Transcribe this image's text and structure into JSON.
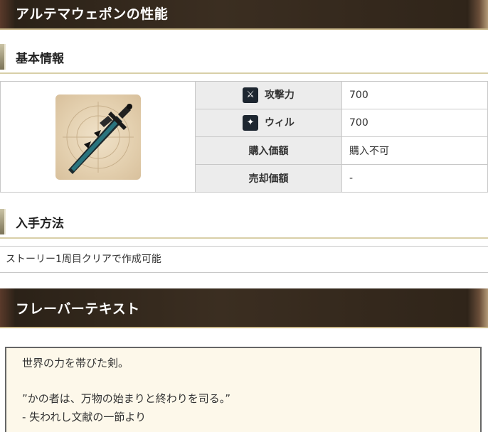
{
  "page_title": "アルテマウェポンの性能",
  "basic_info": {
    "heading": "基本情報",
    "rows": [
      {
        "label": "攻撃力",
        "icon": "sword-icon",
        "value": "700"
      },
      {
        "label": "ウィル",
        "icon": "will-icon",
        "value": "700"
      },
      {
        "label": "購入価額",
        "value": "購入不可"
      },
      {
        "label": "売却価額",
        "value": "-"
      }
    ]
  },
  "acquisition": {
    "heading": "入手方法",
    "text": "ストーリー1周目クリアで作成可能"
  },
  "flavor": {
    "heading": "フレーバーテキスト",
    "line1": "世界の力を帯びた剣。",
    "line2": "”かの者は、万物の始まりと終わりを司る。”",
    "line3": "- 失われし文献の一節より"
  },
  "colors": {
    "header_dark": "#2f2419",
    "header_rule": "#c9b78a",
    "label_bg": "#ececec",
    "flavor_bg": "#fdf8ea"
  }
}
